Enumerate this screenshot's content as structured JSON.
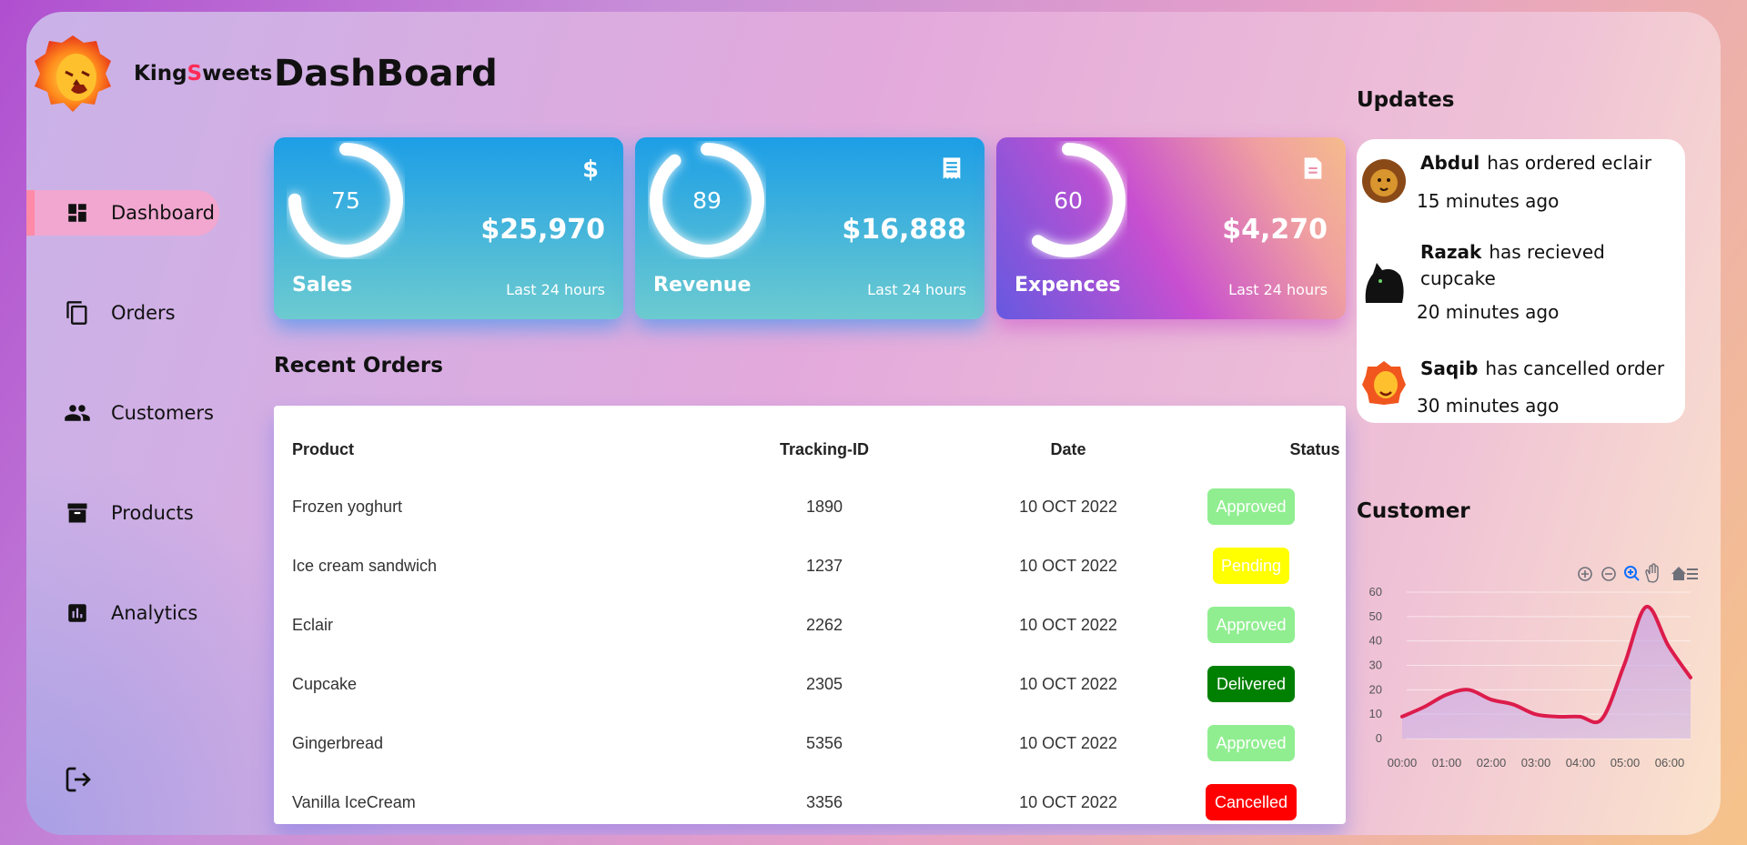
{
  "brand": {
    "prefix": "King",
    "highlight": "S",
    "suffix": "weets"
  },
  "page_title": "DashBoard",
  "sidebar": {
    "items": [
      {
        "label": "Dashboard",
        "icon": "dashboard-icon",
        "active": true
      },
      {
        "label": "Orders",
        "icon": "copy-icon"
      },
      {
        "label": "Customers",
        "icon": "people-icon"
      },
      {
        "label": "Products",
        "icon": "archive-icon"
      },
      {
        "label": "Analytics",
        "icon": "bar-chart-icon"
      }
    ],
    "logout_icon": "sign-out-icon"
  },
  "cards": [
    {
      "name": "Sales",
      "percent": "75",
      "amount": "$25,970",
      "sub": "Last 24 hours",
      "icon": "dollar-icon",
      "fill": 0.75
    },
    {
      "name": "Revenue",
      "percent": "89",
      "amount": "$16,888",
      "sub": "Last 24 hours",
      "icon": "receipt-icon",
      "fill": 0.89
    },
    {
      "name": "Expences",
      "percent": "60",
      "amount": "$4,270",
      "sub": "Last 24 hours",
      "icon": "document-icon",
      "fill": 0.6
    }
  ],
  "recent_orders": {
    "title": "Recent Orders",
    "columns": [
      "Product",
      "Tracking-ID",
      "Date",
      "Status"
    ],
    "rows": [
      {
        "product": "Frozen yoghurt",
        "tracking": "1890",
        "date": "10 OCT 2022",
        "status": "Approved"
      },
      {
        "product": "Ice cream sandwich",
        "tracking": "1237",
        "date": "10 OCT 2022",
        "status": "Pending"
      },
      {
        "product": "Eclair",
        "tracking": "2262",
        "date": "10 OCT 2022",
        "status": "Approved"
      },
      {
        "product": "Cupcake",
        "tracking": "2305",
        "date": "10 OCT 2022",
        "status": "Delivered"
      },
      {
        "product": "Gingerbread",
        "tracking": "5356",
        "date": "10 OCT 2022",
        "status": "Approved"
      },
      {
        "product": "Vanilla IceCream",
        "tracking": "3356",
        "date": "10 OCT 2022",
        "status": "Cancelled"
      }
    ],
    "status_colors": {
      "Approved": "#90ee90",
      "Pending": "#ffff00",
      "Delivered": "#008000",
      "Cancelled": "#ff0000"
    }
  },
  "updates": {
    "title": "Updates",
    "items": [
      {
        "name": "Abdul",
        "text": "has ordered eclair",
        "time": "15 minutes ago"
      },
      {
        "name": "Razak",
        "text": "has recieved cupcake",
        "time": "20 minutes ago"
      },
      {
        "name": "Saqib",
        "text": "has cancelled order",
        "time": "30 minutes ago"
      }
    ]
  },
  "customer": {
    "title": "Customer",
    "toolbar": [
      "zoom-in-icon",
      "zoom-out-icon",
      "zoom-selection-icon",
      "pan-hand-icon",
      "home-reset-icon",
      "menu-icon"
    ]
  },
  "chart_data": {
    "type": "area",
    "categories": [
      "00:00",
      "01:00",
      "02:00",
      "03:00",
      "04:00",
      "05:00",
      "06:00"
    ],
    "x": [
      "00:00",
      "00:30",
      "01:00",
      "01:30",
      "02:00",
      "02:30",
      "03:00",
      "03:30",
      "04:00",
      "04:30",
      "05:00",
      "05:30",
      "06:00",
      "06:30"
    ],
    "series": [
      {
        "values": [
          9,
          13,
          18,
          20,
          16,
          14,
          10,
          9,
          9,
          8,
          30,
          54,
          38,
          25
        ]
      }
    ],
    "ylim": [
      0,
      60
    ],
    "yticks": [
      0,
      10,
      20,
      30,
      40,
      50,
      60
    ],
    "line_color": "#dc1c4b",
    "grid": true
  }
}
